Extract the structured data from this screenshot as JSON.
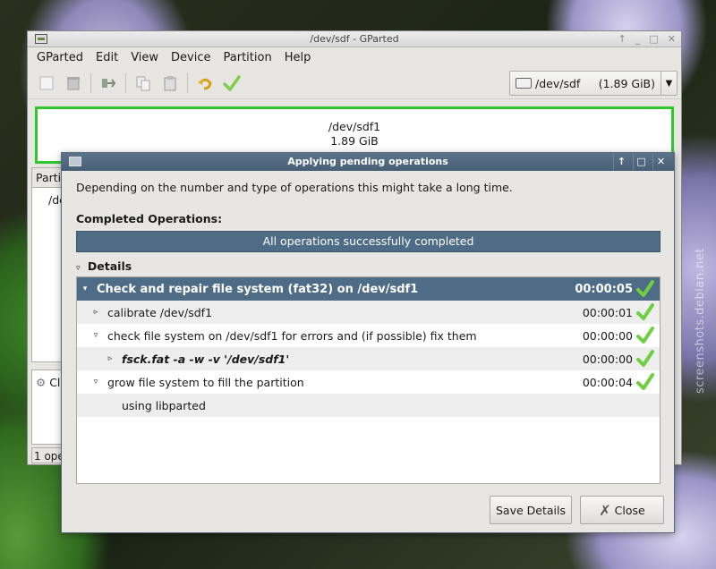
{
  "background": {
    "watermark": "screenshots.debian.net"
  },
  "main_window": {
    "title": "/dev/sdf - GParted",
    "title_controls": [
      "↑",
      "_",
      "□",
      "✕"
    ],
    "menu": [
      "GParted",
      "Edit",
      "View",
      "Device",
      "Partition",
      "Help"
    ],
    "device_select": {
      "value": "/dev/sdf",
      "size": "(1.89 GiB)"
    },
    "partition_visual": {
      "name": "/dev/sdf1",
      "size": "1.89 GiB"
    },
    "table_header_fragment": "Partit",
    "table_cell_fragment": "/de",
    "pending_fragment": "Cl",
    "status_fragment": "1 ope"
  },
  "dialog": {
    "title": "Applying pending operations",
    "controls": [
      "↑",
      "□",
      "✕"
    ],
    "description": "Depending on the number and type of operations this might take a long time.",
    "completed_label": "Completed Operations:",
    "progress_text": "All operations successfully completed",
    "progress_fraction": 1.0,
    "details_label": "Details",
    "tree": [
      {
        "expander": "▾",
        "text": "Check and repair file system (fat32) on /dev/sdf1",
        "time": "00:00:05",
        "level": 0,
        "selected": true,
        "check": true
      },
      {
        "expander": "▹",
        "text": "calibrate /dev/sdf1",
        "time": "00:00:01",
        "level": 1,
        "check": true
      },
      {
        "expander": "▿",
        "text": "check file system on /dev/sdf1 for errors and (if possible) fix them",
        "time": "00:00:00",
        "level": 1,
        "check": true
      },
      {
        "expander": "▹",
        "text": "fsck.fat -a -w -v '/dev/sdf1'",
        "time": "00:00:00",
        "level": 2,
        "italic": true,
        "check": true
      },
      {
        "expander": "▿",
        "text": "grow file system to fill the partition",
        "time": "00:00:04",
        "level": 1,
        "check": true
      },
      {
        "expander": "",
        "text": "using libparted",
        "time": "",
        "level": 2,
        "check": false
      }
    ],
    "buttons": {
      "save": "Save Details",
      "close": "Close"
    },
    "colors": {
      "selection": "#4f6c87",
      "success": "#5bbf2a",
      "titlebar": "#4f6880"
    }
  }
}
